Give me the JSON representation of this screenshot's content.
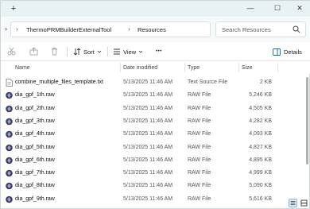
{
  "tabbar": {
    "new_tab_glyph": "+"
  },
  "window_controls": {
    "minimize": "—",
    "maximize": "☐",
    "close": "✕"
  },
  "address": {
    "chevron": "›",
    "separator": "›",
    "crumbs": [
      "ThermoPRMBuilderExternalTool",
      "Resources"
    ],
    "search_placeholder": "Search Resources"
  },
  "commands": {
    "sort_label": "Sort",
    "view_label": "View",
    "more_label": "•••",
    "details_label": "Details"
  },
  "columns": {
    "name": "Name",
    "date": "Date modified",
    "type": "Type",
    "size": "Size"
  },
  "files": [
    {
      "name": "combine_multiple_files_template.txt",
      "date": "5/13/2025 11:46 AM",
      "type": "Text Source File",
      "size": "2 KB",
      "icon": "text-file-icon"
    },
    {
      "name": "dia_gpf_1th.raw",
      "date": "5/13/2025 11:46 AM",
      "type": "RAW File",
      "size": "5,246 KB",
      "icon": "raw-file-icon"
    },
    {
      "name": "dia_gpf_2th.raw",
      "date": "5/13/2025 11:46 AM",
      "type": "RAW File",
      "size": "4,505 KB",
      "icon": "raw-file-icon"
    },
    {
      "name": "dia_gpf_3th.raw",
      "date": "5/13/2025 11:46 AM",
      "type": "RAW File",
      "size": "4,282 KB",
      "icon": "raw-file-icon"
    },
    {
      "name": "dia_gpf_4th.raw",
      "date": "5/13/2025 11:46 AM",
      "type": "RAW File",
      "size": "4,093 KB",
      "icon": "raw-file-icon"
    },
    {
      "name": "dia_gpf_5th.raw",
      "date": "5/13/2025 11:46 AM",
      "type": "RAW File",
      "size": "4,827 KB",
      "icon": "raw-file-icon"
    },
    {
      "name": "dia_gpf_6th.raw",
      "date": "5/13/2025 11:46 AM",
      "type": "RAW File",
      "size": "4,895 KB",
      "icon": "raw-file-icon"
    },
    {
      "name": "dia_gpf_7th.raw",
      "date": "5/13/2025 11:46 AM",
      "type": "RAW File",
      "size": "4,999 KB",
      "icon": "raw-file-icon"
    },
    {
      "name": "dia_gpf_8th.raw",
      "date": "5/13/2025 11:46 AM",
      "type": "RAW File",
      "size": "5,090 KB",
      "icon": "raw-file-icon"
    },
    {
      "name": "dia_gpf_9th.raw",
      "date": "5/13/2025 11:46 AM",
      "type": "RAW File",
      "size": "5,616 KB",
      "icon": "raw-file-icon"
    }
  ],
  "colors": {
    "titlebar": "#e8f2f4",
    "raw_icon": "#3d3f5c",
    "accent": "#0067c0"
  }
}
